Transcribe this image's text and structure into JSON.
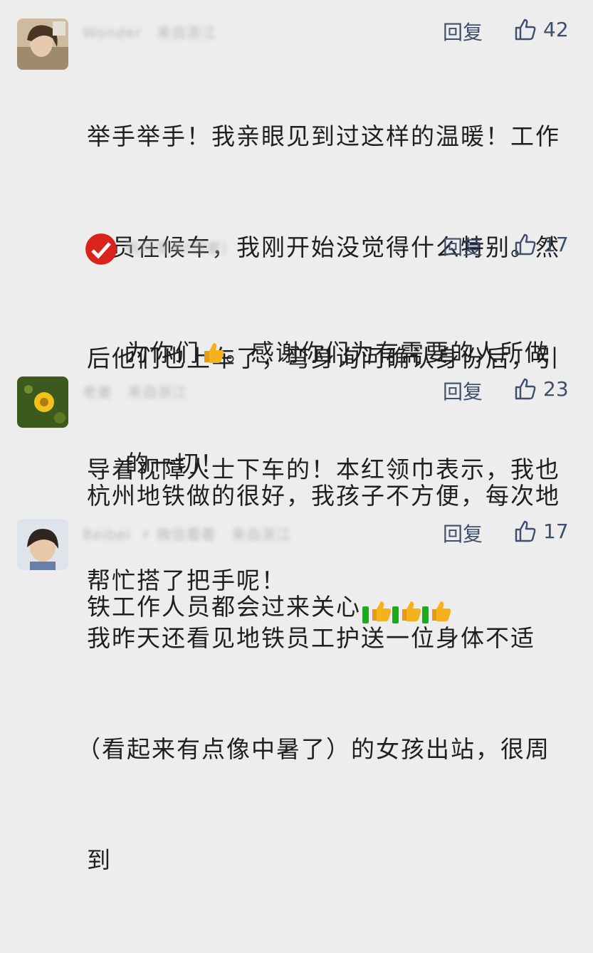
{
  "comments": [
    {
      "name": "Wonder",
      "location": "来自浙江",
      "reply_label": "回复",
      "likes": "42",
      "text": "举手举手！我亲眼见到过这样的温暖！工作人员在候车，我刚开始没觉得什么特别。然后他们也上车了，弯身询问确认身份后，引导着视障人士下车的！本红领巾表示，我也帮忙搭了把手呢！",
      "lines": [
        "举手举手！我亲眼见到过这样的温暖！工作",
        "人员在候车，我刚开始没觉得什么特别。然",
        "后他们也上车了，弯身询问确认身份后，引",
        "导着视障人士下车的！本红领巾表示，我也",
        "帮忙搭了把手呢！"
      ],
      "reply": {
        "name": "杭州发布(作者)",
        "reply_label": "回复",
        "likes": "17",
        "line1_pre": "为你们",
        "line1_post": "。感谢你们为有需要的人所做",
        "line2": "的一切！",
        "emoji": "thumbs-up"
      }
    },
    {
      "name": "老姜",
      "location": "来自浙江",
      "reply_label": "回复",
      "likes": "23",
      "line1": "杭州地铁做的很好，我孩子不方便，每次地",
      "line2": "铁工作人员都会过来关心",
      "emoji": "thumbs-up-green-badge"
    },
    {
      "name": "Beibei",
      "badge": "⚡ 微信看看",
      "location": "来自浙江",
      "reply_label": "回复",
      "likes": "17",
      "lines": [
        "我昨天还看见地铁员工护送一位身体不适",
        "（看起来有点像中暑了）的女孩出站，很周",
        "到"
      ]
    }
  ],
  "colors": {
    "background": "#ededed",
    "link": "#3f4e6b",
    "text": "#1f1f1f",
    "emoji_yellow": "#f6b21c"
  }
}
